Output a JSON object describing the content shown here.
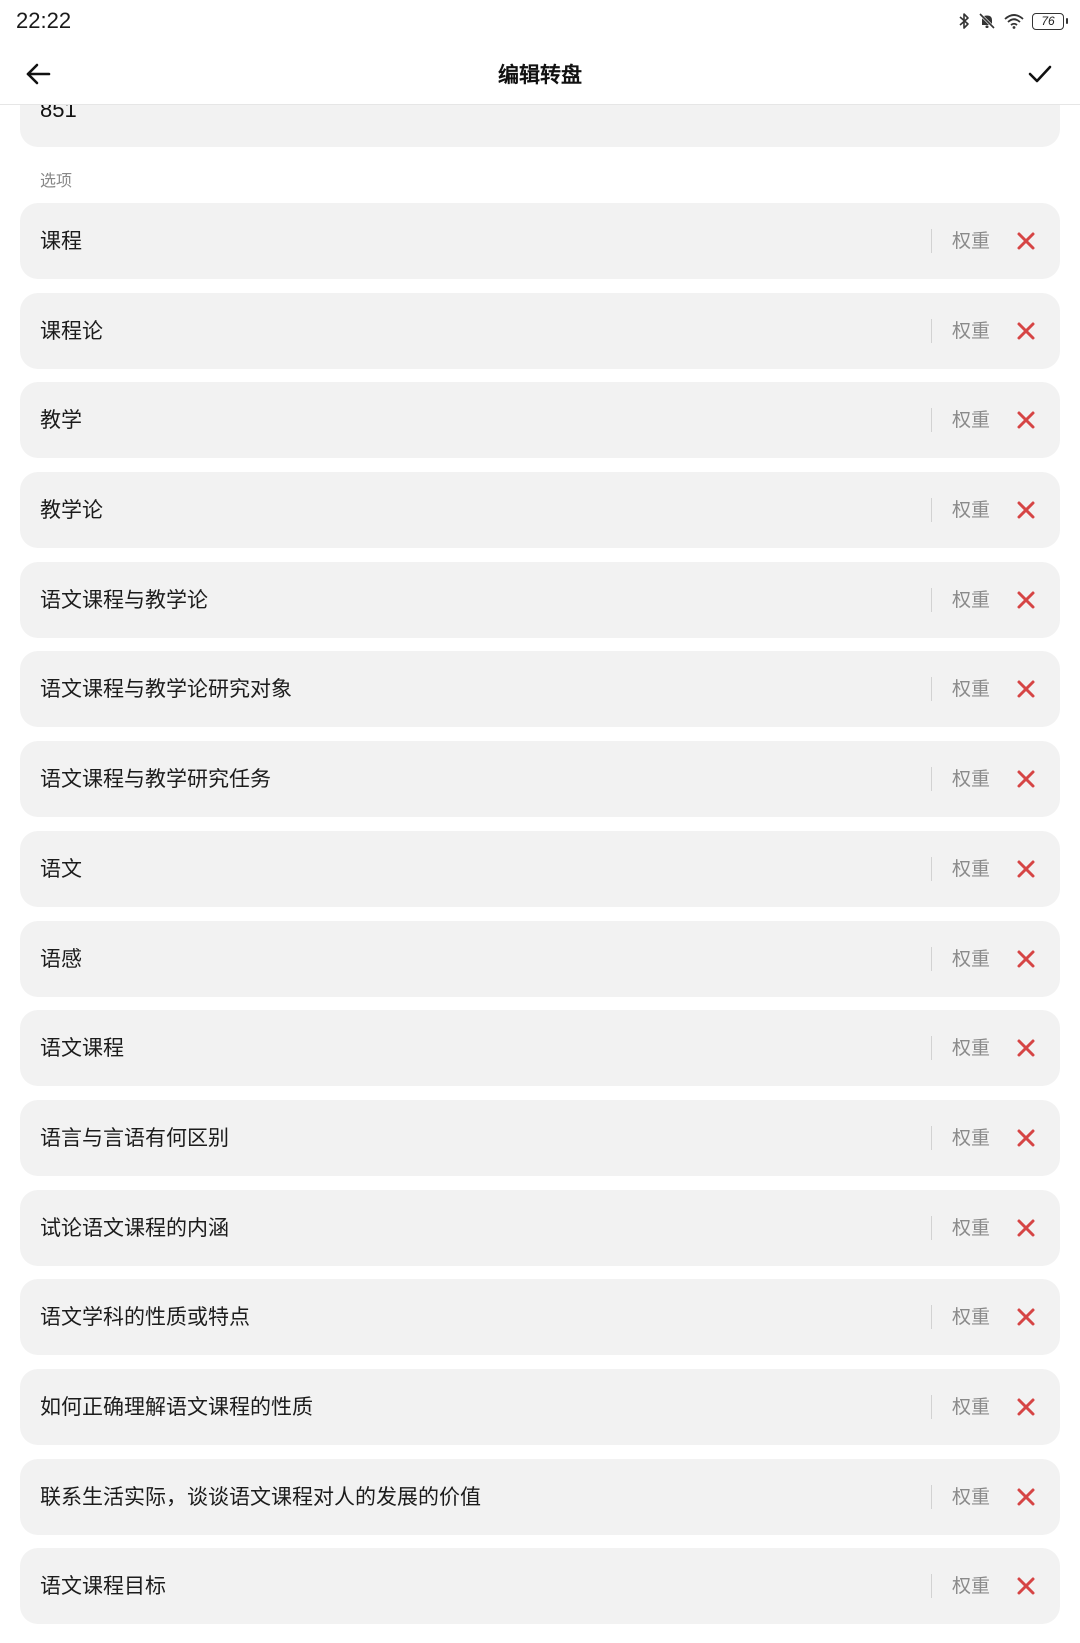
{
  "status_bar": {
    "time": "22:22",
    "battery": "76",
    "icons": [
      "bluetooth-icon",
      "mute-icon",
      "wifi-icon",
      "battery-icon"
    ]
  },
  "app_bar": {
    "title": "编辑转盘",
    "back_icon": "arrow-left-icon",
    "confirm_icon": "check-icon"
  },
  "form": {
    "name_value": "851",
    "options_label": "选项",
    "weight_label": "权重",
    "delete_icon": "close-icon",
    "delete_color": "#d64545",
    "options": [
      "课程",
      "课程论",
      "教学",
      "教学论",
      "语文课程与教学论",
      "语文课程与教学论研究对象",
      "语文课程与教学研究任务",
      "语文",
      "语感",
      "语文课程",
      "语言与言语有何区别",
      "试论语文课程的内涵",
      "语文学科的性质或特点",
      "如何正确理解语文课程的性质",
      "联系生活实际，谈谈语文课程对人的发展的价值",
      "语文课程目标"
    ]
  }
}
